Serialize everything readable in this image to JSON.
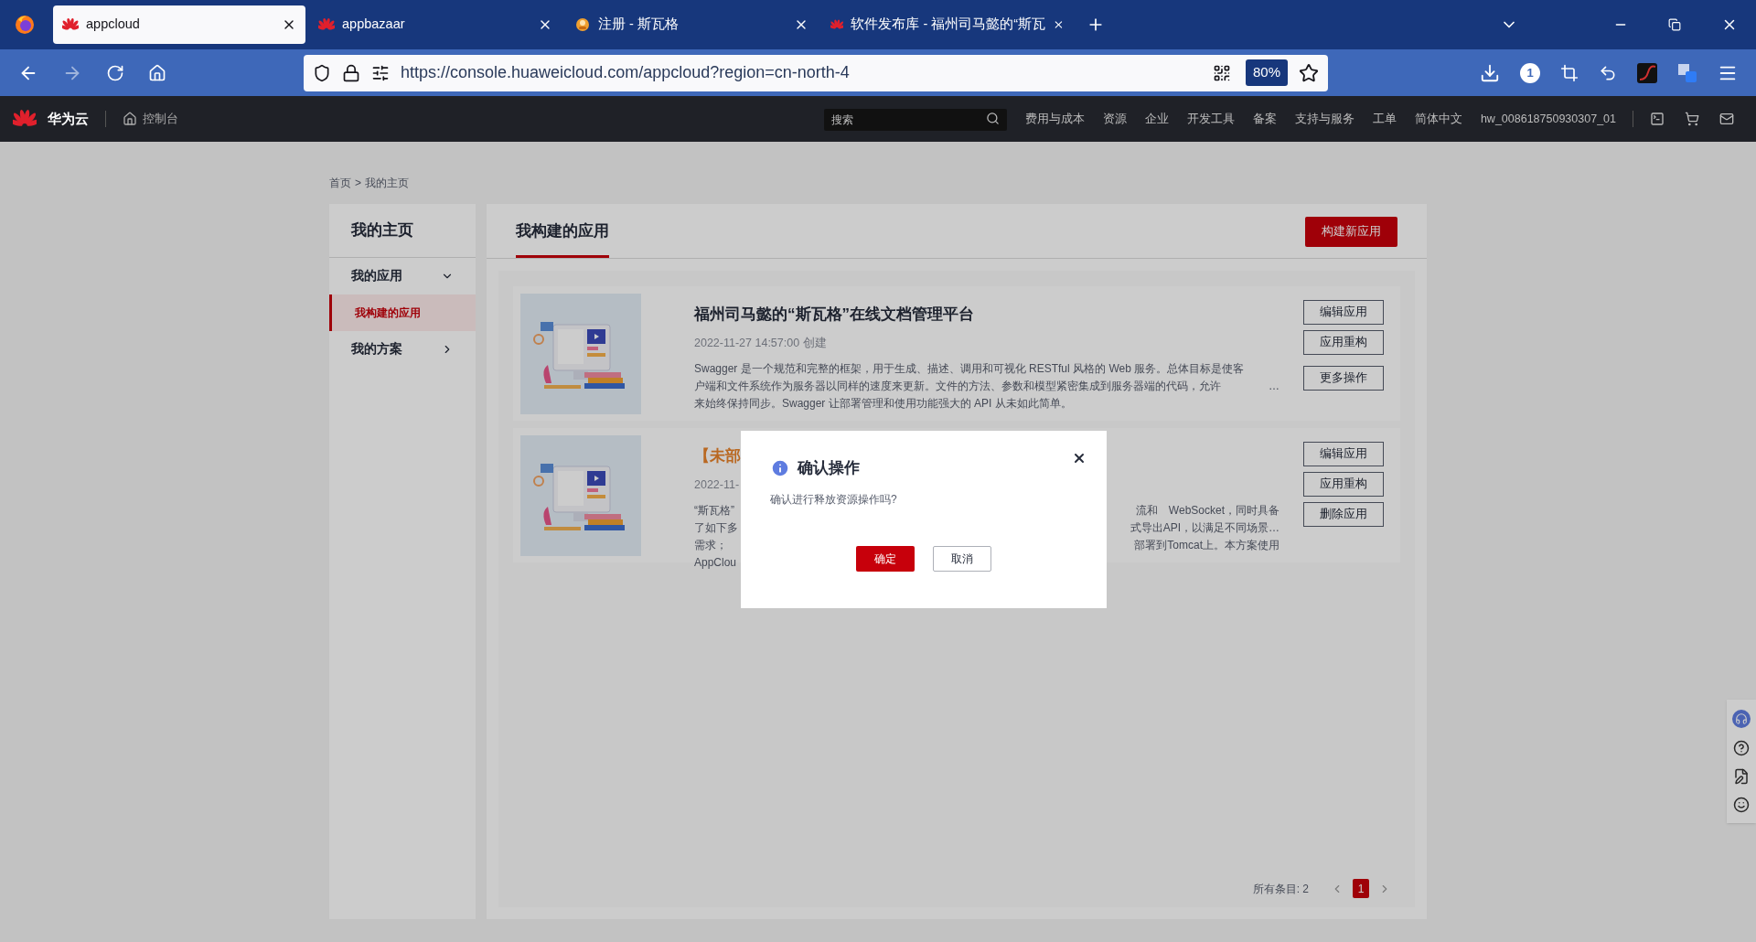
{
  "browser": {
    "tabs": [
      {
        "title": "appcloud",
        "kind": "petal",
        "selected": true
      },
      {
        "title": "appbazaar",
        "kind": "petal",
        "selected": false
      },
      {
        "title": "注册 - 斯瓦格",
        "kind": "mascot",
        "selected": false
      },
      {
        "title": "软件发布库 - 福州司马懿的“斯瓦",
        "kind": "petal",
        "selected": false
      }
    ],
    "url": {
      "host": "https://console.huaweicloud.com",
      "path": "/appcloud?region=cn-north-4"
    },
    "zoom": "80%",
    "extension_badge": "1"
  },
  "header": {
    "brand": "华为云",
    "console": "控制台",
    "search": {
      "placeholder": "搜索"
    },
    "nav": [
      "费用与成本",
      "资源",
      "企业",
      "开发工具",
      "备案",
      "支持与服务",
      "工单",
      "简体中文",
      "hw_008618750930307_01"
    ]
  },
  "breadcrumb": {
    "items": [
      "首页",
      "我的主页"
    ],
    "separator": ">"
  },
  "sidebar": {
    "title": "我的主页",
    "items": [
      {
        "label": "我的应用",
        "expanded": true,
        "children": [
          {
            "label": "我构建的应用",
            "selected": true
          }
        ]
      },
      {
        "label": "我的方案",
        "expanded": false
      }
    ]
  },
  "main": {
    "tabs": [
      {
        "label": "我构建的应用",
        "selected": true
      }
    ],
    "create_button": "构建新应用"
  },
  "apps": [
    {
      "kind": "normal",
      "title": "福州司马懿的“斯瓦格”在线文档管理平台",
      "date": "2022-11-27 14:57:00 创建",
      "lines": [
        {
          "text": "Swagger 是一个规范和完整的框架，用于生成、描述、调用和可视化 RESTful 风格的 Web 服务。总体目标是使客"
        },
        {
          "text": "户端和文件系统作为服务器以同样的速度来更新。文件的方法、参数和模型紧密集成到服务器端的代码，允许",
          "tail": "…"
        },
        {
          "text": "来始终保持同步。Swagger 让部署管理和使用功能强大的 API 从未如此简单。"
        }
      ],
      "buttons": [
        "编辑应用",
        "应用重构",
        "更多操作"
      ]
    },
    {
      "kind": "pending",
      "title": "【未部",
      "date": "2022-11-",
      "lines": [
        {
          "text": "“斯瓦格”",
          "tail": "流和　WebSocket，同时具备"
        },
        {
          "text": "了如下多",
          "tail": "式导出API，以满足不同场景…"
        },
        {
          "text": "需求；",
          "tail": "部署到Tomcat上。本方案使用"
        },
        {
          "text": "AppClou"
        }
      ],
      "buttons": [
        "编辑应用",
        "应用重构",
        "删除应用"
      ]
    }
  ],
  "pagination": {
    "total": "所有条目: 2",
    "pages": [
      {
        "label": "1",
        "selected": true
      }
    ]
  },
  "dialog": {
    "title": "确认操作",
    "message": "确认进行释放资源操作吗?",
    "confirm": "确定",
    "cancel": "取消"
  }
}
